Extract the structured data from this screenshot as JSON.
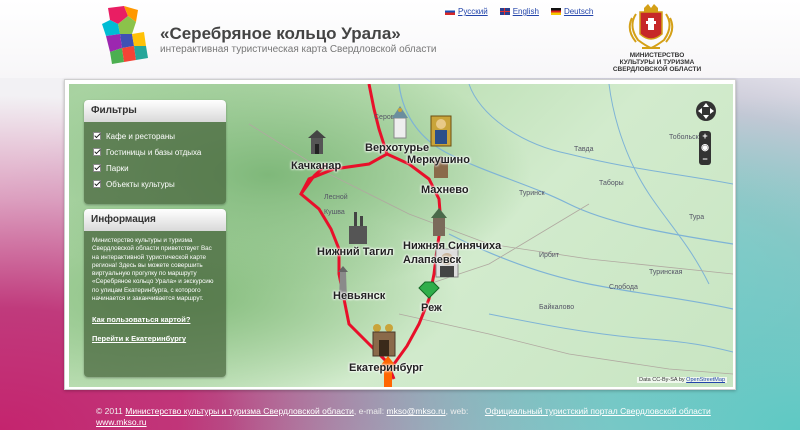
{
  "header": {
    "title": "«Серебряное кольцо Урала»",
    "subtitle": "интерактивная туристическая карта Свердловской области",
    "languages": [
      {
        "label": "Русский",
        "flag": "ru"
      },
      {
        "label": "English",
        "flag": "en"
      },
      {
        "label": "Deutsch",
        "flag": "de"
      }
    ],
    "ministry": [
      "Министерство",
      "культуры и туризма",
      "Свердловской области"
    ]
  },
  "filters": {
    "title": "Фильтры",
    "items": [
      {
        "label": "Кафе и рестораны",
        "checked": true
      },
      {
        "label": "Гостиницы и базы отдыха",
        "checked": true
      },
      {
        "label": "Парки",
        "checked": true
      },
      {
        "label": "Объекты культуры",
        "checked": true
      }
    ]
  },
  "info": {
    "title": "Информация",
    "text": "Министерство культуры и туризма Свердловской области приветствует Вас на интерактивной туристической карте региона! Здесь вы можете совершить виртуальную прогулку по маршруту «Серебряное кольцо Урала» и экскурсию по улицам Екатеринбурга, с которого начинается и заканчивается маршрут.",
    "link_how": "Как пользоваться картой?",
    "link_city": "Перейти к Екатеринбургу"
  },
  "map": {
    "cities": {
      "kachkanar": "Качканар",
      "verkhoturye": "Верхотурье",
      "merkushino": "Меркушино",
      "makhnevo": "Махнево",
      "nizhny_tagil": "Нижний Тагил",
      "nizhnyaya_sinyachikha": "Нижняя Синячиха",
      "alapaevsk": "Алапаевск",
      "nevyansk": "Невьянск",
      "rezh": "Реж",
      "ekaterinburg": "Екатеринбург"
    },
    "minor_labels": [
      "Тавда",
      "Тобольск",
      "Туринск",
      "Таборы",
      "Ирбит",
      "Слобода",
      "Туринская",
      "Байкалово",
      "Серов",
      "Лесной",
      "Кушва",
      "Тура"
    ],
    "attribution_prefix": "Data CC-By-SA by",
    "attribution_link": "OpenStreetMap",
    "zoom_in": "+",
    "zoom_out": "−",
    "route_color": "#e8102a",
    "marker_color": "#ff6600"
  },
  "footer": {
    "copyright": "© 2011",
    "ministry_link": "Министерство культуры и туризма Свердловской области",
    "email_label": ", e-mail:",
    "email": "mkso@mkso.ru",
    "web_label": ", web:",
    "web": "www.mkso.ru",
    "portal_link": "Официальный туристский портал Свердловской области"
  }
}
